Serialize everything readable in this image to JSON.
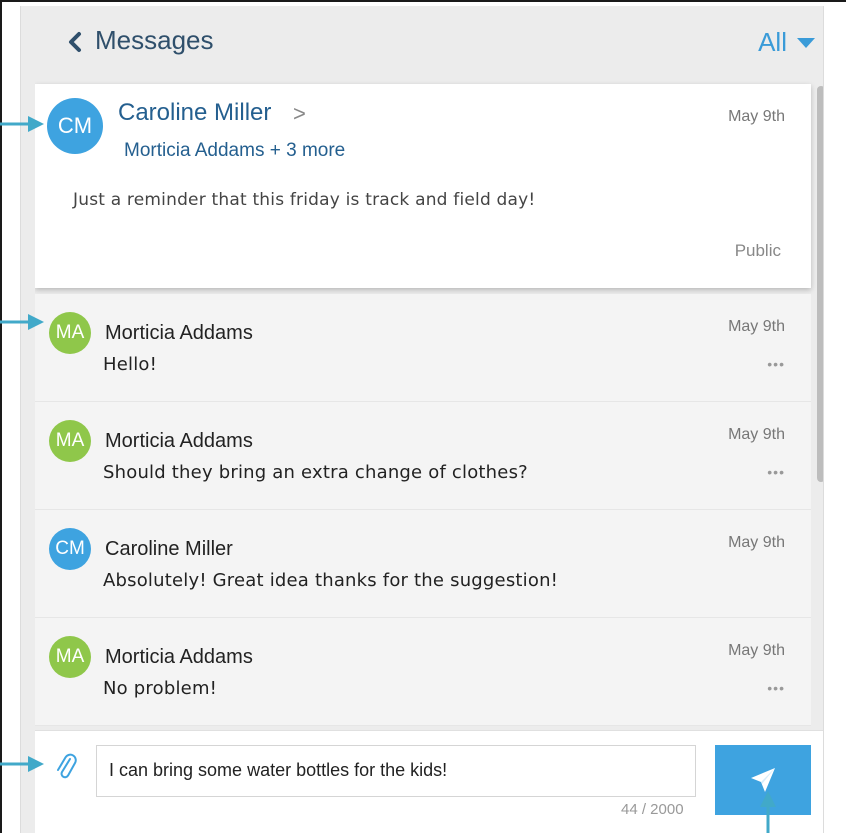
{
  "header": {
    "title": "Messages",
    "filter_label": "All"
  },
  "original_message": {
    "sender_initials": "CM",
    "sender_name": "Caroline Miller",
    "recipients": "Morticia Addams + 3 more",
    "date": "May 9th",
    "body": "Just a reminder that this friday is track and field day!",
    "visibility": "Public"
  },
  "replies": [
    {
      "initials": "MA",
      "name": "Morticia Addams",
      "date": "May 9th",
      "text": "Hello!",
      "color": "#8fc74a"
    },
    {
      "initials": "MA",
      "name": "Morticia Addams",
      "date": "May 9th",
      "text": "Should they bring an extra change of clothes?",
      "color": "#8fc74a"
    },
    {
      "initials": "CM",
      "name": "Caroline Miller",
      "date": "May 9th",
      "text": "Absolutely! Great idea thanks for the suggestion!",
      "color": "#3ea3e0"
    },
    {
      "initials": "MA",
      "name": "Morticia Addams",
      "date": "May 9th",
      "text": "No problem!",
      "color": "#8fc74a"
    }
  ],
  "composer": {
    "value": "I can bring some water bottles for the kids!",
    "char_count": "44 / 2000"
  },
  "colors": {
    "accent": "#3ea3e0",
    "green_avatar": "#8fc74a",
    "annotation_arrow": "#41a9c9"
  },
  "icons": {
    "back": "back-icon",
    "filter": "caret-down-icon",
    "more": "more-icon",
    "attach": "paperclip-icon",
    "send": "send-icon"
  }
}
